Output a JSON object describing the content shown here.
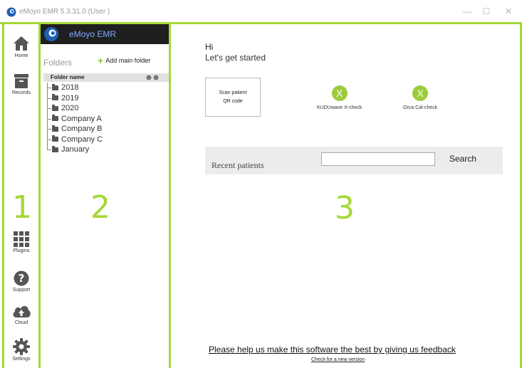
{
  "window": {
    "title": "eMoyo EMR 5.3.31.0 (User )",
    "minimize_symbol": "—",
    "maximize_symbol": "☐",
    "close_symbol": "✕"
  },
  "nav": {
    "items": [
      {
        "label": "Home",
        "icon": "home-icon"
      },
      {
        "label": "Records",
        "icon": "records-icon"
      },
      {
        "label": "Plugins",
        "icon": "plugins-icon"
      },
      {
        "label": "Support",
        "icon": "support-icon"
      },
      {
        "label": "Cloud",
        "icon": "cloud-icon"
      },
      {
        "label": "Settings",
        "icon": "settings-icon"
      }
    ]
  },
  "zones": {
    "one": "1",
    "two": "2",
    "three": "3"
  },
  "folders": {
    "brand": "eMoyo EMR",
    "title": "Folders",
    "add_label": "Add main folder",
    "column_header": "Folder name",
    "items": [
      "2018",
      "2019",
      "2020",
      "Company A",
      "Company B",
      "Company C",
      "January"
    ]
  },
  "main": {
    "greeting": "Hi",
    "subtitle": "Let's get started",
    "scan_line1": "Scan patient",
    "scan_line2": "QR code",
    "devices": [
      {
        "label": "KUDUwave X-check",
        "symbol": "X"
      },
      {
        "label": "Orca Cal-check",
        "symbol": "X"
      }
    ],
    "recent_label": "Recent patients",
    "search_value": "",
    "search_label": "Search",
    "feedback_link": "Please help us make this software the best by giving us feedback",
    "update_link": "Check for a new version"
  },
  "colors": {
    "accent_green": "#a4d936",
    "device_green": "#9ccc3c",
    "header_dark": "#1f1f1f",
    "brand_blue": "#7fa8ff"
  }
}
